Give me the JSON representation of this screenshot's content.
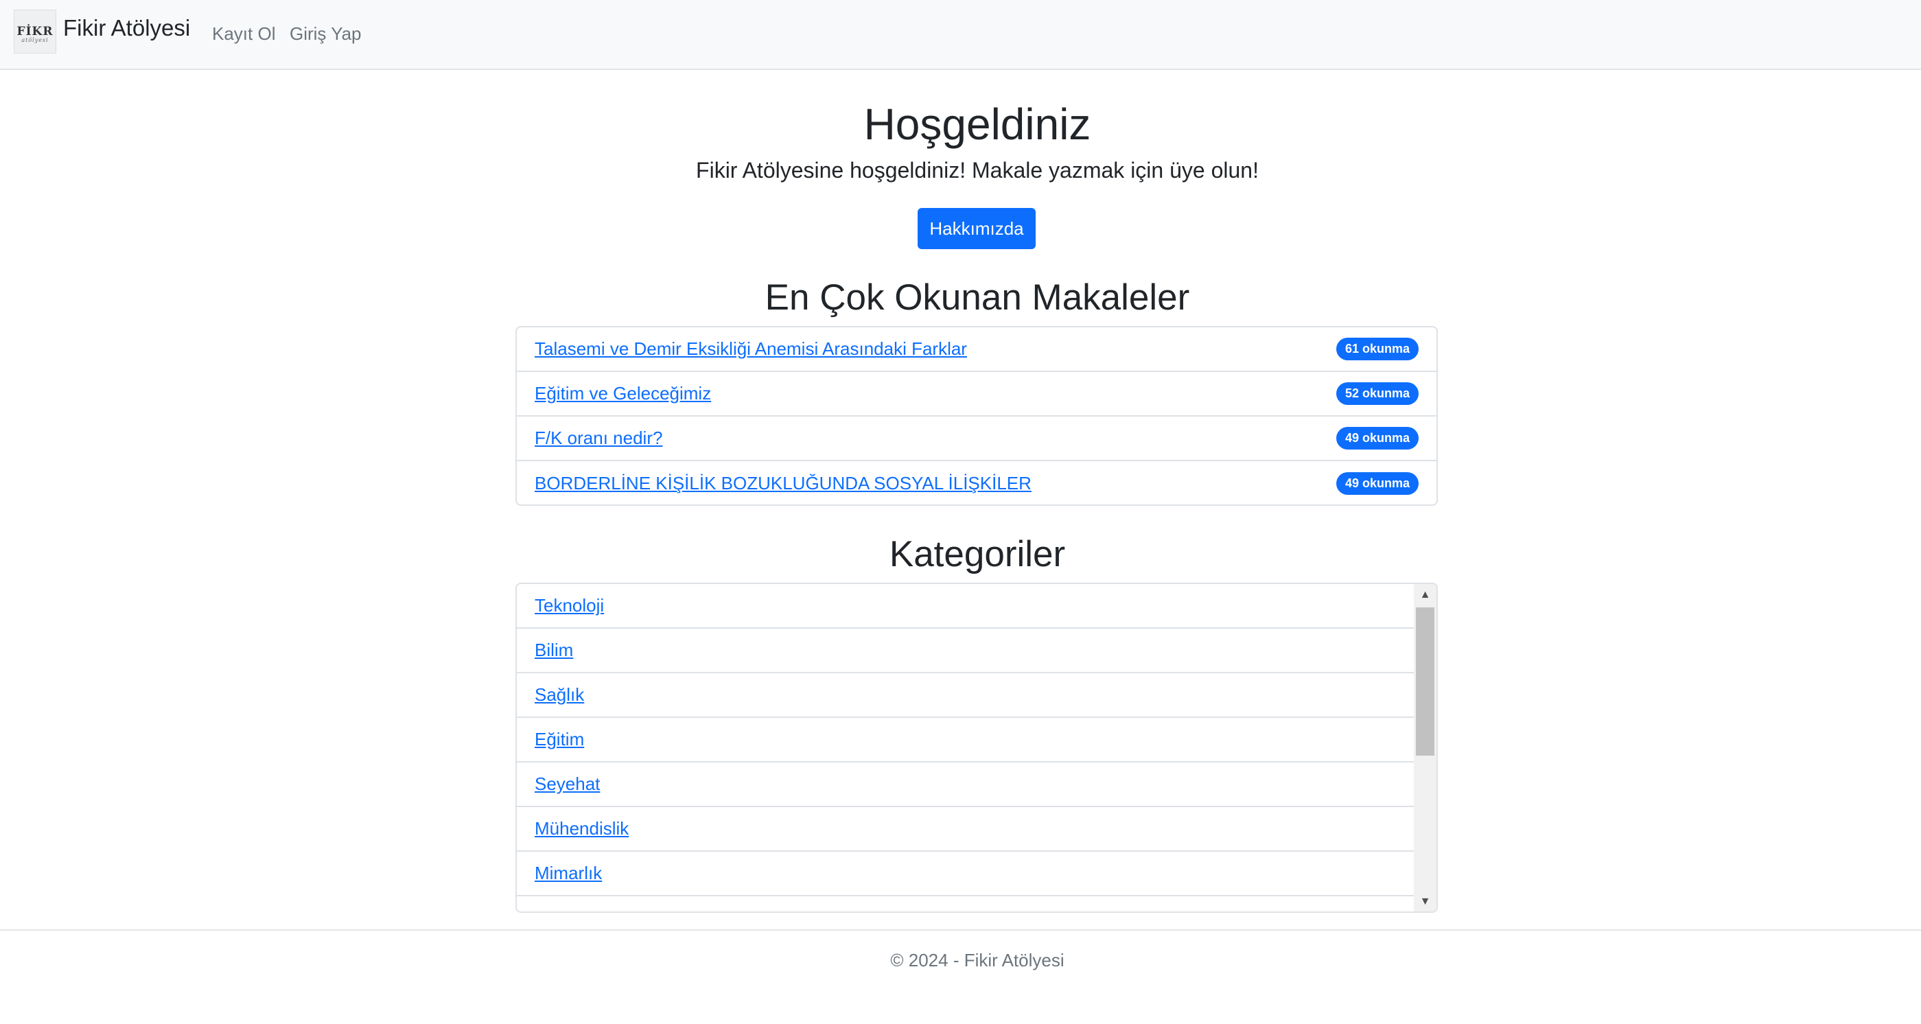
{
  "navbar": {
    "brand_logo_text": "FİKR",
    "brand_logo_sub": "atölyesi",
    "brand_name": "Fikir Atölyesi",
    "links": [
      "Kayıt Ol",
      "Giriş Yap"
    ]
  },
  "hero": {
    "title": "Hoşgeldiniz",
    "lead": "Fikir Atölyesine hoşgeldiniz! Makale yazmak için üye olun!",
    "button_label": "Hakkımızda"
  },
  "popular": {
    "title": "En Çok Okunan Makaleler",
    "items": [
      {
        "title": "Talasemi ve Demir Eksikliği Anemisi Arasındaki Farklar",
        "badge": "61 okunma"
      },
      {
        "title": "Eğitim ve Geleceğimiz",
        "badge": "52 okunma"
      },
      {
        "title": "F/K oranı nedir?",
        "badge": "49 okunma"
      },
      {
        "title": "BORDERLİNE KİŞİLİK BOZUKLUĞUNDA SOSYAL İLİŞKİLER",
        "badge": "49 okunma"
      }
    ]
  },
  "categories": {
    "title": "Kategoriler",
    "items": [
      "Teknoloji",
      "Bilim",
      "Sağlık",
      "Eğitim",
      "Seyehat",
      "Mühendislik",
      "Mimarlık"
    ]
  },
  "footer": {
    "text": "© 2024 - Fikir Atölyesi"
  },
  "colors": {
    "primary": "#0d6efd",
    "navbar_bg": "#f8f9fa",
    "muted_text": "#6c757d"
  }
}
